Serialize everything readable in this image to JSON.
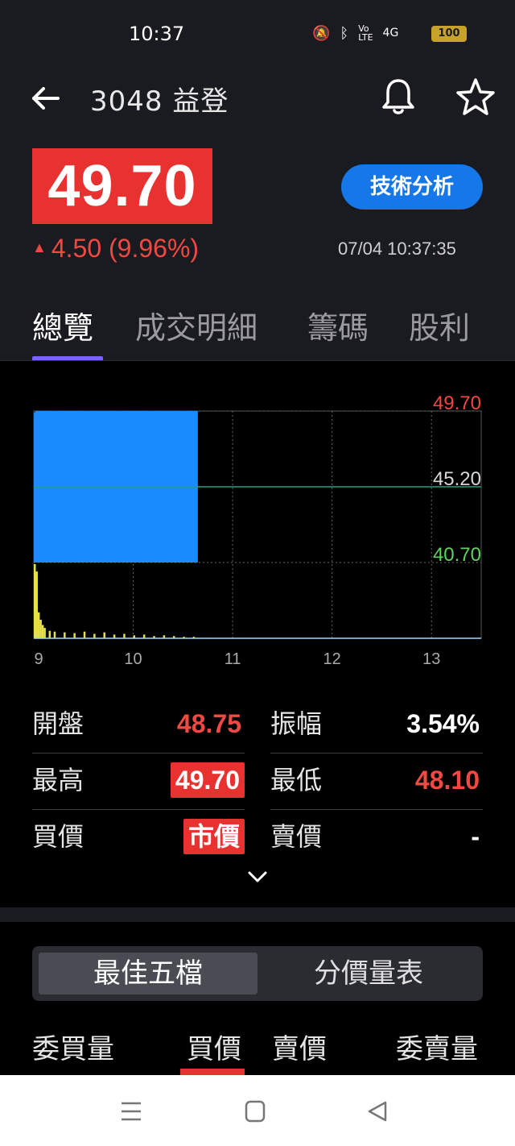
{
  "status_bar": {
    "time": "10:37",
    "battery": "100",
    "network": "4G"
  },
  "header": {
    "title": "3048 益登",
    "price": "49.70",
    "change": "4.50 (9.96%)",
    "datetime": "07/04 10:37:35",
    "tech_button": "技術分析"
  },
  "tabs": [
    "總覽",
    "成交明細",
    "籌碼",
    "股利"
  ],
  "chart_data": {
    "type": "area",
    "x_ticks": [
      "9",
      "10",
      "11",
      "12",
      "13"
    ],
    "y_ticks": [
      "49.70",
      "45.20",
      "40.70"
    ],
    "ylim": [
      40.7,
      49.7
    ],
    "reference_price": 45.2,
    "price_series": {
      "x_hours": [
        9.0,
        9.02,
        9.05,
        9.1,
        9.5,
        10.0,
        10.5,
        10.65
      ],
      "values": [
        49.55,
        49.7,
        49.7,
        49.7,
        49.7,
        49.7,
        49.7,
        49.7
      ]
    },
    "volume_series": {
      "x_hours": [
        9.0,
        9.02,
        9.04,
        9.06,
        9.08,
        9.1,
        9.15,
        9.2,
        9.3,
        9.4,
        9.5,
        9.6,
        9.7,
        9.8,
        9.9,
        10.0,
        10.1,
        10.2,
        10.3,
        10.4,
        10.5,
        10.6
      ],
      "values": [
        100,
        90,
        35,
        25,
        18,
        14,
        10,
        9,
        8,
        7,
        9,
        6,
        8,
        5,
        6,
        4,
        5,
        3,
        4,
        3,
        2,
        2
      ]
    },
    "colors": {
      "price_fill": "#1a8cff",
      "volume": "#e6e04a",
      "up": "#f04842",
      "down": "#5fd35f",
      "ref": "#1fa08a"
    }
  },
  "stats": {
    "open_label": "開盤",
    "open": "48.75",
    "amplitude_label": "振幅",
    "amplitude": "3.54%",
    "high_label": "最高",
    "high": "49.70",
    "low_label": "最低",
    "low": "48.10",
    "bid_label": "買價",
    "bid": "市價",
    "ask_label": "賣價",
    "ask": "-"
  },
  "segment": {
    "best5": "最佳五檔",
    "price_volume": "分價量表"
  },
  "order_book_headers": {
    "bid_qty": "委買量",
    "bid_price": "買價",
    "ask_price": "賣價",
    "ask_qty": "委賣量"
  },
  "colors": {
    "header_bg": "#1a1b20",
    "up_red": "#f04842",
    "accent_blue": "#1677e8",
    "tab_underline": "#7b61ff"
  }
}
